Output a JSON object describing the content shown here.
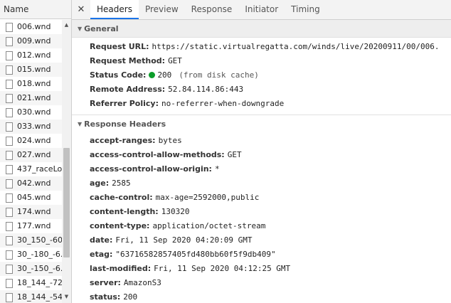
{
  "left_panel": {
    "header": "Name",
    "files": [
      "006.wnd",
      "009.wnd",
      "012.wnd",
      "015.wnd",
      "018.wnd",
      "021.wnd",
      "030.wnd",
      "033.wnd",
      "024.wnd",
      "027.wnd",
      "437_raceLo",
      "042.wnd",
      "045.wnd",
      "174.wnd",
      "177.wnd",
      "30_150_-60",
      "30_-180_-6...",
      "30_-150_-6...",
      "18_144_-72",
      "18_144_-54"
    ],
    "scroll_up_glyph": "▲",
    "scroll_down_glyph": "▼"
  },
  "tabs": {
    "close_glyph": "✕",
    "items": [
      "Headers",
      "Preview",
      "Response",
      "Initiator",
      "Timing"
    ],
    "active": "Headers"
  },
  "general": {
    "title": "General",
    "request_url_key": "Request URL:",
    "request_url": "https://static.virtualregatta.com/winds/live/20200911/00/006.",
    "request_method_key": "Request Method:",
    "request_method": "GET",
    "status_code_key": "Status Code:",
    "status_code": "200",
    "status_note": "(from disk cache)",
    "remote_address_key": "Remote Address:",
    "remote_address": "52.84.114.86:443",
    "referrer_policy_key": "Referrer Policy:",
    "referrer_policy": "no-referrer-when-downgrade"
  },
  "response_headers": {
    "title": "Response Headers",
    "rows": [
      {
        "key": "accept-ranges:",
        "value": "bytes"
      },
      {
        "key": "access-control-allow-methods:",
        "value": "GET"
      },
      {
        "key": "access-control-allow-origin:",
        "value": "*"
      },
      {
        "key": "age:",
        "value": "2585"
      },
      {
        "key": "cache-control:",
        "value": "max-age=2592000,public"
      },
      {
        "key": "content-length:",
        "value": "130320"
      },
      {
        "key": "content-type:",
        "value": "application/octet-stream"
      },
      {
        "key": "date:",
        "value": "Fri, 11 Sep 2020 04:20:09 GMT"
      },
      {
        "key": "etag:",
        "value": "\"63716582857405fd480bb60f5f9db409\""
      },
      {
        "key": "last-modified:",
        "value": "Fri, 11 Sep 2020 04:12:25 GMT"
      },
      {
        "key": "server:",
        "value": "AmazonS3"
      },
      {
        "key": "status:",
        "value": "200"
      }
    ]
  },
  "colors": {
    "active_tab_underline": "#1a73e8",
    "status_ok": "#0b9d2a"
  },
  "icons": {
    "file": "file-icon",
    "close": "close-icon",
    "expand": "triangle-down-icon",
    "status": "status-dot-icon"
  }
}
